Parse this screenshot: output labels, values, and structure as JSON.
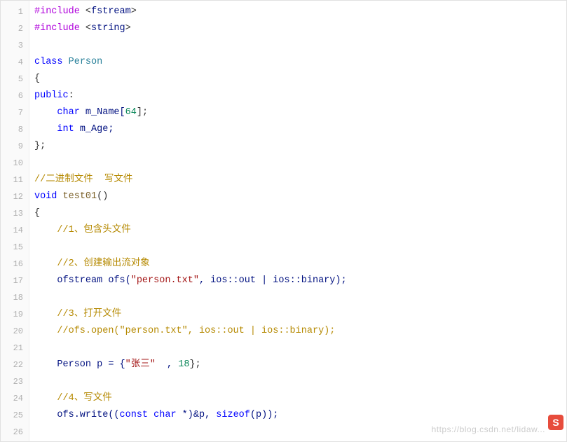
{
  "code": {
    "lines": [
      {
        "n": "1",
        "tokens": [
          {
            "t": "#include",
            "c": "preproc"
          },
          {
            "t": " ",
            "c": ""
          },
          {
            "t": "<",
            "c": "punc"
          },
          {
            "t": "fstream",
            "c": "ident"
          },
          {
            "t": ">",
            "c": "punc"
          }
        ]
      },
      {
        "n": "2",
        "tokens": [
          {
            "t": "#include",
            "c": "preproc"
          },
          {
            "t": " ",
            "c": ""
          },
          {
            "t": "<",
            "c": "punc"
          },
          {
            "t": "string",
            "c": "ident"
          },
          {
            "t": ">",
            "c": "punc"
          }
        ]
      },
      {
        "n": "3",
        "tokens": []
      },
      {
        "n": "4",
        "tokens": [
          {
            "t": "class",
            "c": "kw"
          },
          {
            "t": " ",
            "c": ""
          },
          {
            "t": "Person",
            "c": "cls"
          }
        ]
      },
      {
        "n": "5",
        "tokens": [
          {
            "t": "{",
            "c": "punc"
          }
        ]
      },
      {
        "n": "6",
        "tokens": [
          {
            "t": "public",
            "c": "kw"
          },
          {
            "t": ":",
            "c": "punc"
          }
        ]
      },
      {
        "n": "7",
        "tokens": [
          {
            "t": "    ",
            "c": ""
          },
          {
            "t": "char",
            "c": "type"
          },
          {
            "t": " ",
            "c": ""
          },
          {
            "t": "m_Name[",
            "c": "ident"
          },
          {
            "t": "64",
            "c": "num"
          },
          {
            "t": "];",
            "c": "punc"
          }
        ]
      },
      {
        "n": "8",
        "tokens": [
          {
            "t": "    ",
            "c": ""
          },
          {
            "t": "int",
            "c": "type"
          },
          {
            "t": " ",
            "c": ""
          },
          {
            "t": "m_Age;",
            "c": "ident"
          }
        ]
      },
      {
        "n": "9",
        "tokens": [
          {
            "t": "};",
            "c": "punc"
          }
        ]
      },
      {
        "n": "10",
        "tokens": []
      },
      {
        "n": "11",
        "tokens": [
          {
            "t": "//二进制文件  写文件",
            "c": "cmt"
          }
        ]
      },
      {
        "n": "12",
        "tokens": [
          {
            "t": "void",
            "c": "type"
          },
          {
            "t": " ",
            "c": ""
          },
          {
            "t": "test01",
            "c": "func"
          },
          {
            "t": "()",
            "c": "punc"
          }
        ]
      },
      {
        "n": "13",
        "tokens": [
          {
            "t": "{",
            "c": "punc"
          }
        ]
      },
      {
        "n": "14",
        "tokens": [
          {
            "t": "    ",
            "c": ""
          },
          {
            "t": "//1、包含头文件",
            "c": "cmt"
          }
        ]
      },
      {
        "n": "15",
        "tokens": []
      },
      {
        "n": "16",
        "tokens": [
          {
            "t": "    ",
            "c": ""
          },
          {
            "t": "//2、创建输出流对象",
            "c": "cmt"
          }
        ]
      },
      {
        "n": "17",
        "tokens": [
          {
            "t": "    ",
            "c": ""
          },
          {
            "t": "ofstream ofs(",
            "c": "ident"
          },
          {
            "t": "\"person.txt\"",
            "c": "str"
          },
          {
            "t": ", ios::out | ios::binary);",
            "c": "ident"
          }
        ]
      },
      {
        "n": "18",
        "tokens": []
      },
      {
        "n": "19",
        "tokens": [
          {
            "t": "    ",
            "c": ""
          },
          {
            "t": "//3、打开文件",
            "c": "cmt"
          }
        ]
      },
      {
        "n": "20",
        "tokens": [
          {
            "t": "    ",
            "c": ""
          },
          {
            "t": "//ofs.open(\"person.txt\", ios::out | ios::binary);",
            "c": "cmt"
          }
        ]
      },
      {
        "n": "21",
        "tokens": []
      },
      {
        "n": "22",
        "tokens": [
          {
            "t": "    ",
            "c": ""
          },
          {
            "t": "Person p = {",
            "c": "ident"
          },
          {
            "t": "\"张三\"",
            "c": "str"
          },
          {
            "t": "  , ",
            "c": "ident"
          },
          {
            "t": "18",
            "c": "num"
          },
          {
            "t": "};",
            "c": "punc"
          }
        ]
      },
      {
        "n": "23",
        "tokens": []
      },
      {
        "n": "24",
        "tokens": [
          {
            "t": "    ",
            "c": ""
          },
          {
            "t": "//4、写文件",
            "c": "cmt"
          }
        ]
      },
      {
        "n": "25",
        "tokens": [
          {
            "t": "    ",
            "c": ""
          },
          {
            "t": "ofs.write((",
            "c": "ident"
          },
          {
            "t": "const",
            "c": "kw"
          },
          {
            "t": " ",
            "c": ""
          },
          {
            "t": "char",
            "c": "type"
          },
          {
            "t": " *)&p, ",
            "c": "ident"
          },
          {
            "t": "sizeof",
            "c": "kw"
          },
          {
            "t": "(p));",
            "c": "ident"
          }
        ]
      },
      {
        "n": "26",
        "tokens": []
      }
    ]
  },
  "watermark": "https://blog.csdn.net/lidaw...",
  "badge": "S"
}
